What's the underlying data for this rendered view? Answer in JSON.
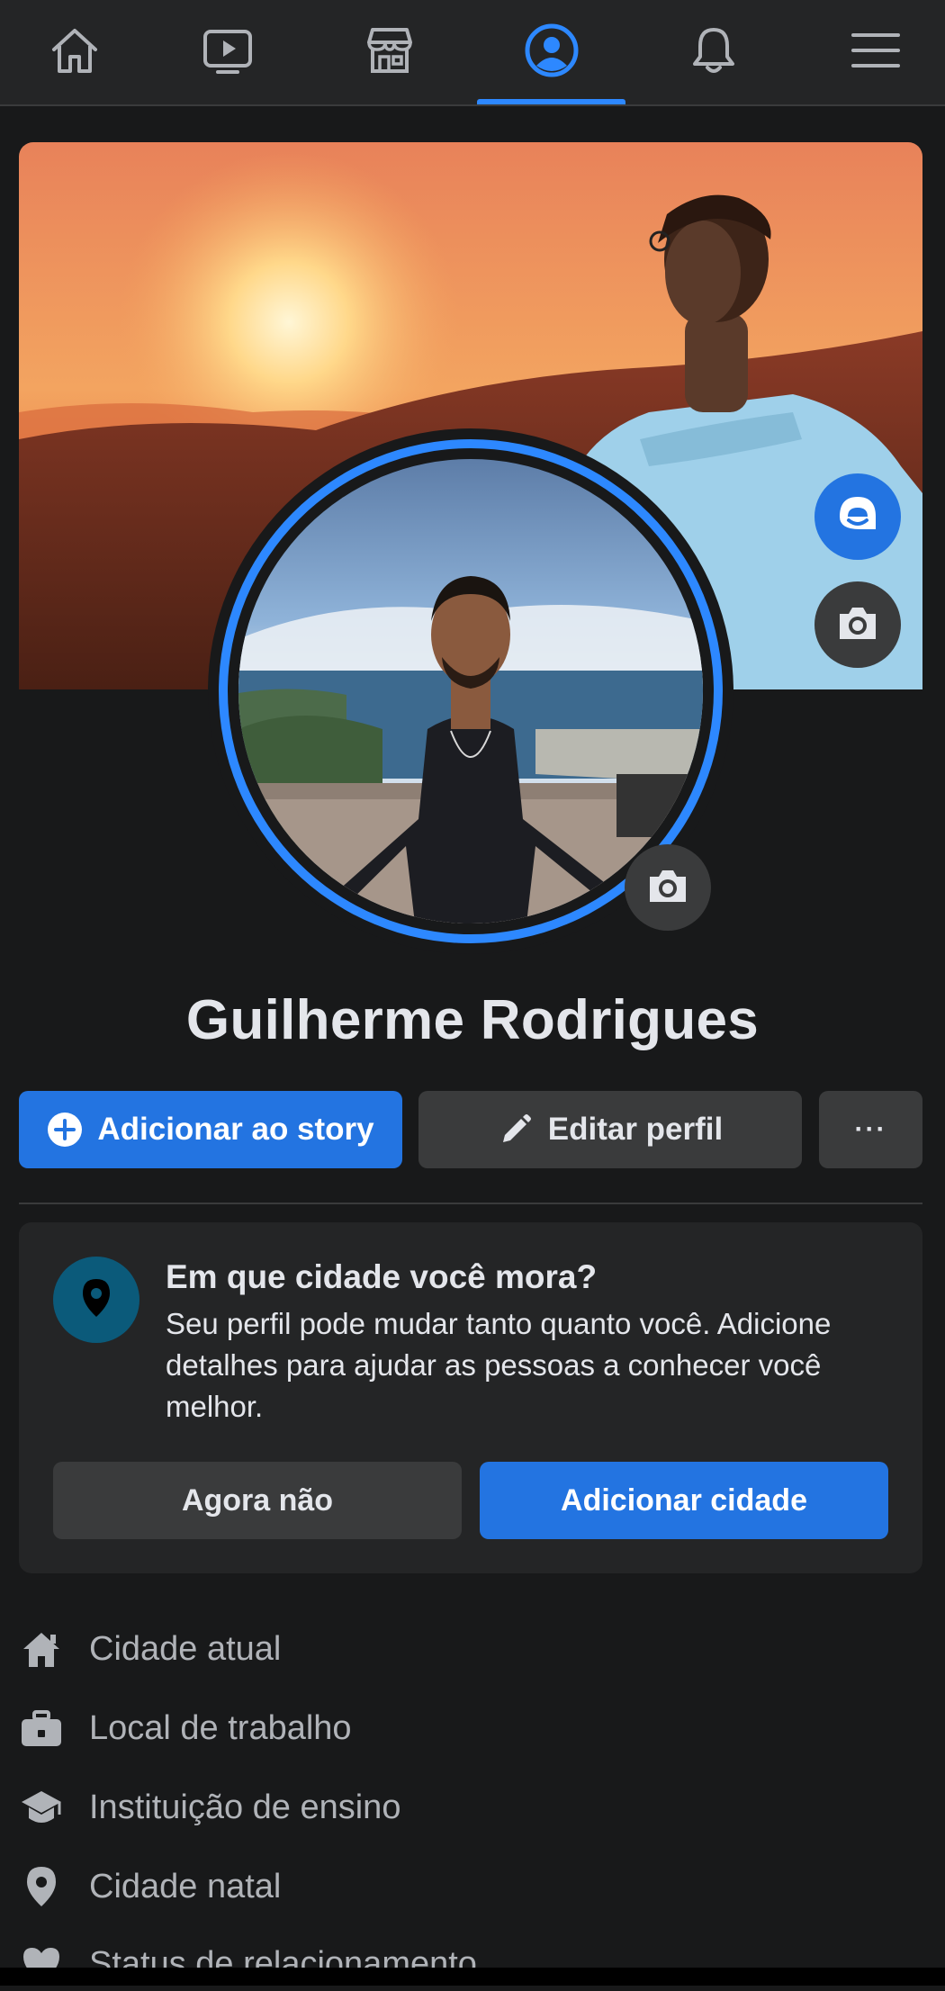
{
  "nav": {
    "tabs": [
      {
        "icon": "home-icon"
      },
      {
        "icon": "watch-icon"
      },
      {
        "icon": "marketplace-icon"
      },
      {
        "icon": "profile-icon",
        "active": true
      },
      {
        "icon": "notifications-icon"
      },
      {
        "icon": "menu-icon"
      }
    ]
  },
  "colors": {
    "accent": "#2d88ff",
    "primary_button": "#2374e1",
    "background": "#18191a",
    "surface": "#242526",
    "secondary_button": "#3a3b3c"
  },
  "cover": {
    "avatar_button_icon": "avatar-icon",
    "camera_button_icon": "camera-icon"
  },
  "profile": {
    "name": "Guilherme Rodrigues"
  },
  "actions": {
    "add_story_label": "Adicionar ao story",
    "edit_profile_label": "Editar perfil",
    "more_label": "···"
  },
  "city_card": {
    "title": "Em que cidade você mora?",
    "description": "Seu perfil pode mudar tanto quanto você. Adicione detalhes para ajudar as pessoas a conhecer você melhor.",
    "dismiss_label": "Agora não",
    "add_label": "Adicionar cidade"
  },
  "details": [
    {
      "icon": "house-icon",
      "label": "Cidade atual"
    },
    {
      "icon": "briefcase-icon",
      "label": "Local de trabalho"
    },
    {
      "icon": "graduation-cap-icon",
      "label": "Instituição de ensino"
    },
    {
      "icon": "location-pin-icon",
      "label": "Cidade natal"
    },
    {
      "icon": "heart-icon",
      "label": "Status de relacionamento"
    }
  ]
}
